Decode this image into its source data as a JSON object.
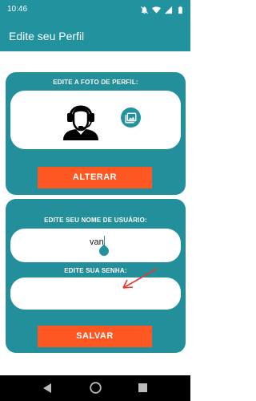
{
  "status_bar": {
    "time": "10:46"
  },
  "app_bar": {
    "title": "Edite seu Perfil"
  },
  "photo_card": {
    "heading": "EDITE A FOTO DE PERFIL:",
    "change_button": "ALTERAR"
  },
  "user_card": {
    "username_heading": "EDITE SEU NOME DE USUÁRIO:",
    "username_value": "van",
    "password_heading": "EDITE SUA SENHA:",
    "password_value": "",
    "save_button": "SALVAR"
  },
  "colors": {
    "teal": "#22929f",
    "card": "#238f9b",
    "orange": "#ff5722",
    "annotation_arrow": "#e53935"
  },
  "icons": [
    "notifications-off-icon",
    "wifi-icon",
    "cellular-icon",
    "battery-icon",
    "avatar-headset-icon",
    "gallery-icon",
    "back-icon",
    "home-icon",
    "recents-icon"
  ]
}
